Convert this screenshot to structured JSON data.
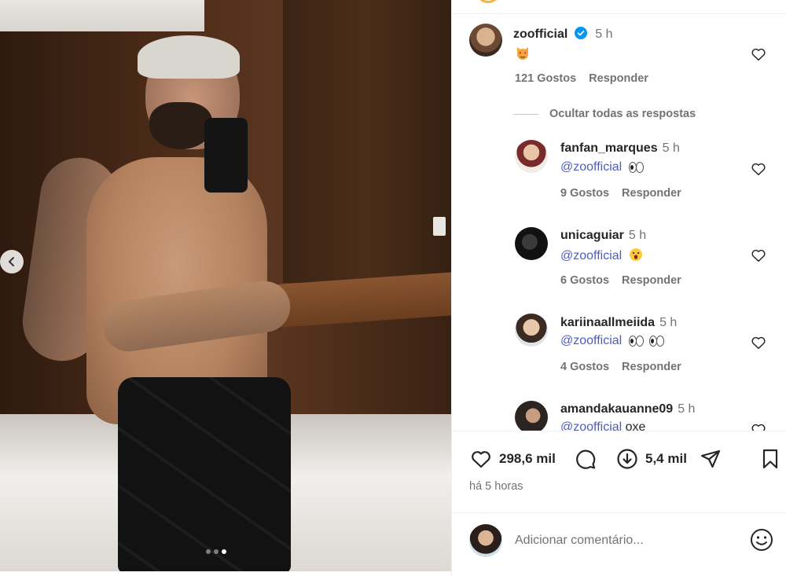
{
  "post": {
    "carousel": {
      "slide_count": 3,
      "active_slide": 3
    }
  },
  "main_comment": {
    "username": "zoofficial",
    "verified": true,
    "time": "5 h",
    "text_emoji": "cat-with-heart-eyes",
    "likes": "121 Gostos",
    "reply_label": "Responder"
  },
  "hide_replies_label": "Ocultar todas as respostas",
  "replies": [
    {
      "username": "fanfan_marques",
      "time": "5 h",
      "mention": "@zoofficial",
      "emoji": "eyes",
      "likes": "9 Gostos",
      "reply_label": "Responder"
    },
    {
      "username": "unicaguiar",
      "time": "5 h",
      "mention": "@zoofficial",
      "emoji": "face-with-open-mouth",
      "likes": "6 Gostos",
      "reply_label": "Responder"
    },
    {
      "username": "kariinaallmeiida",
      "time": "5 h",
      "mention": "@zoofficial",
      "emoji": "eyes eyes",
      "likes": "4 Gostos",
      "reply_label": "Responder"
    },
    {
      "username": "amandakauanne09",
      "time": "5 h",
      "mention": "@zoofficial",
      "text": "oxe"
    }
  ],
  "actions": {
    "likes": "298,6 mil",
    "shares": "5,4 mil",
    "posted_ago": "há 5 horas"
  },
  "add_comment": {
    "placeholder": "Adicionar comentário..."
  },
  "colors": {
    "mention": "#4a5ec2",
    "verified": "#0095f6",
    "muted": "#737373"
  }
}
